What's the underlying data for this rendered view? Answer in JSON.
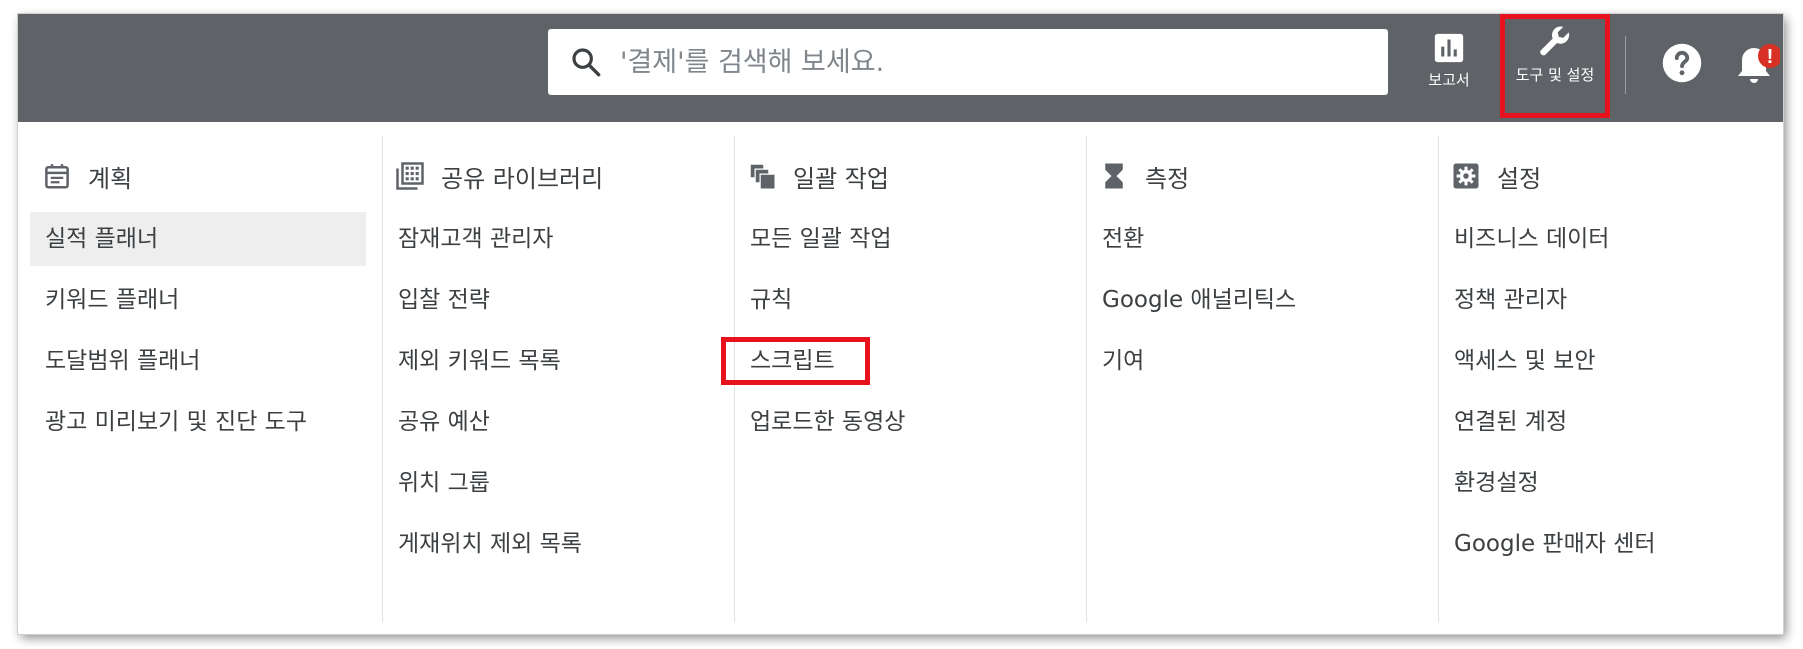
{
  "topbar": {
    "search": {
      "placeholder": "'결제'를 검색해 보세요."
    },
    "reports_label": "보고서",
    "tools_label": "도구 및 설정",
    "help_icon": "help-circle-icon",
    "notifications_icon": "bell-icon",
    "notification_badge": "!",
    "colors": {
      "bar_bg": "#5f6368",
      "highlight": "#e8121f"
    }
  },
  "menu": {
    "columns": [
      {
        "icon": "calendar-icon",
        "title": "계획",
        "items": [
          "실적 플래너",
          "키워드 플래너",
          "도달범위 플래너",
          "광고 미리보기 및 진단 도구"
        ]
      },
      {
        "icon": "library-icon",
        "title": "공유 라이브러리",
        "items": [
          "잠재고객 관리자",
          "입찰 전략",
          "제외 키워드 목록",
          "공유 예산",
          "위치 그룹",
          "게재위치 제외 목록"
        ]
      },
      {
        "icon": "copy-icon",
        "title": "일괄 작업",
        "items": [
          "모든 일괄 작업",
          "규칙",
          "스크립트",
          "업로드한 동영상"
        ]
      },
      {
        "icon": "hourglass-icon",
        "title": "측정",
        "items": [
          "전환",
          "Google 애널리틱스",
          "기여"
        ]
      },
      {
        "icon": "settings-icon",
        "title": "설정",
        "items": [
          "비즈니스 데이터",
          "정책 관리자",
          "액세스 및 보안",
          "연결된 계정",
          "환경설정",
          "Google 판매자 센터"
        ]
      }
    ]
  }
}
